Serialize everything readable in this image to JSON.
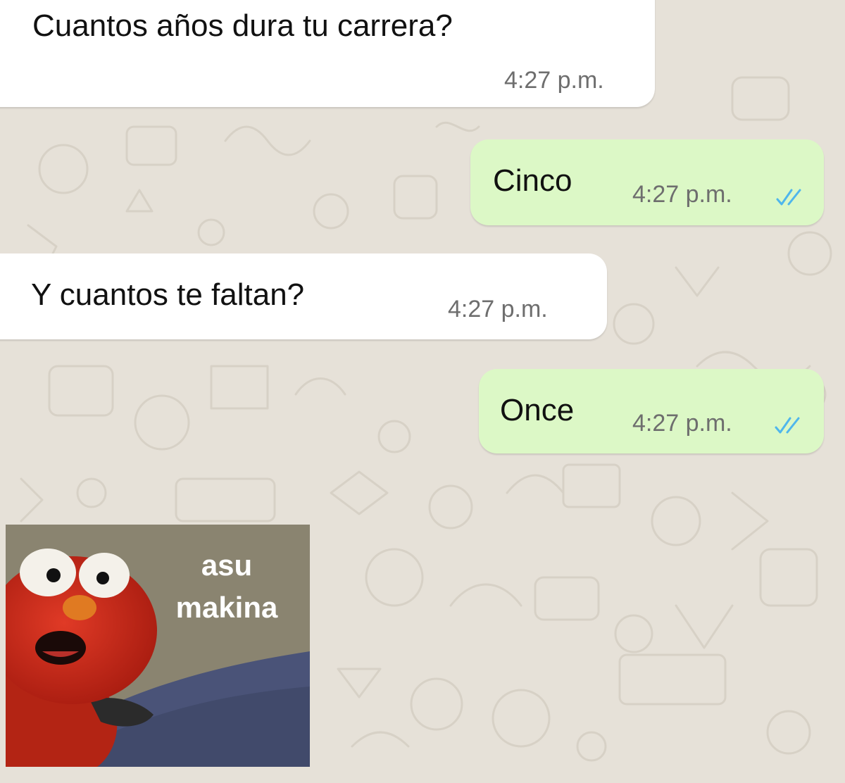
{
  "colors": {
    "background": "#e6e1d8",
    "incoming_bubble": "#ffffff",
    "outgoing_bubble": "#dcf8c6",
    "read_ticks": "#4fb6ec",
    "timestamp": "#6e6e6e"
  },
  "messages": [
    {
      "direction": "incoming",
      "text": "Cuantos años dura tu carrera?",
      "time": "4:27 p.m."
    },
    {
      "direction": "outgoing",
      "text": "Cinco",
      "time": "4:27 p.m.",
      "status_icon": "double-check-read-icon"
    },
    {
      "direction": "incoming",
      "text": "Y cuantos te faltan?",
      "time": "4:27 p.m."
    },
    {
      "direction": "outgoing",
      "text": "Once",
      "time": "4:27 p.m.",
      "status_icon": "double-check-read-icon"
    }
  ],
  "sticker": {
    "line1": "asu",
    "line2": "makina"
  }
}
